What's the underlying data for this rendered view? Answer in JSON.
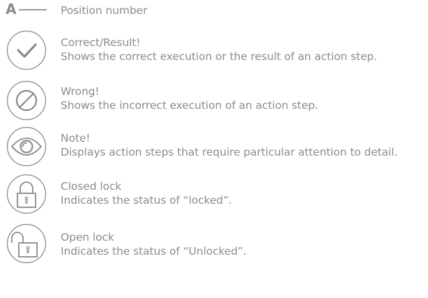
{
  "position": {
    "letter": "A",
    "label": "Position number"
  },
  "entries": [
    {
      "icon": "checkmark-icon",
      "title": "Correct/Result!",
      "description": "Shows the correct execution or the result of an action step."
    },
    {
      "icon": "prohibited-icon",
      "title": "Wrong!",
      "description": "Shows the incorrect execution of an action step."
    },
    {
      "icon": "eye-icon",
      "title": "Note!",
      "description": "Displays action steps that require particular attention to detail."
    },
    {
      "icon": "closed-lock-icon",
      "title": "Closed lock",
      "description": "Indicates the status of “locked”."
    },
    {
      "icon": "open-lock-icon",
      "title": "Open lock",
      "description": "Indicates the status of “Unlocked”."
    }
  ],
  "colors": {
    "text": "#8c8c8c",
    "icon_stroke": "#8a8a8a"
  }
}
